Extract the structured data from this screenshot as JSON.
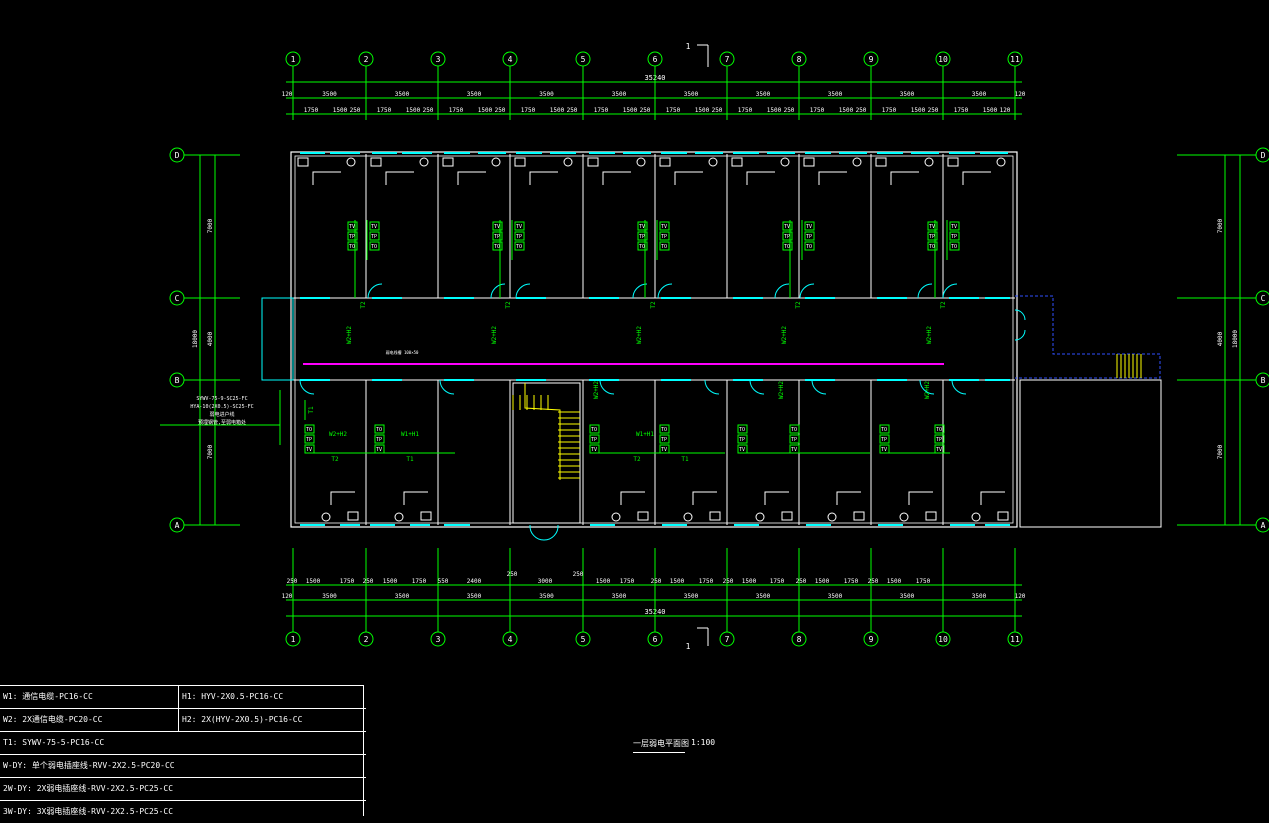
{
  "axes_h": [
    "1",
    "2",
    "3",
    "4",
    "5",
    "6",
    "7",
    "8",
    "9",
    "10",
    "11"
  ],
  "axes_v": [
    "D",
    "C",
    "B",
    "A"
  ],
  "section_mark": "1",
  "dims": {
    "total": "35240",
    "edge": "120",
    "bays": [
      "3500",
      "3500",
      "3500",
      "3500",
      "3500",
      "3500",
      "3500",
      "3500",
      "3500",
      "3500"
    ],
    "top_detail": [
      "1750",
      "1500",
      "250",
      "1750",
      "1500",
      "250",
      "1750",
      "1500",
      "250",
      "1750",
      "1500",
      "250",
      "1750",
      "1500",
      "250",
      "1750",
      "1500",
      "250",
      "1750",
      "1500",
      "250",
      "1750",
      "1500",
      "250",
      "1750",
      "1500",
      "250",
      "1750",
      "1500",
      "120"
    ],
    "bottom_detail": [
      "250",
      "1500",
      "1750",
      "250",
      "1500",
      "1750",
      "550",
      "2400",
      "3000",
      "1500",
      "1750",
      "250",
      "1500",
      "1750",
      "250",
      "1500",
      "1750",
      "250",
      "1500",
      "1750",
      "250",
      "1500",
      "1750"
    ],
    "bottom_extra": [
      "250",
      "250"
    ],
    "left": [
      "7000",
      "4000",
      "7000",
      "18000"
    ],
    "right": [
      "7000",
      "4000",
      "7000",
      "18000"
    ]
  },
  "labels": {
    "riser_tv": "TV",
    "riser_tp": "TP",
    "riser_to": "TO",
    "w2h2": "W2+H2",
    "w1h1": "W1+H1",
    "t2": "T2",
    "t1": "T1",
    "left_notes": [
      "SYWV-75-9-SC25-FC",
      "HYA-10(2X0.5)-SC25-FC",
      "弱电进户线",
      "预埋钢管,至弱电箱处"
    ],
    "corridor_note": "弱电线槽 100×50"
  },
  "legend": {
    "r1a": "W1:  通信电缆-PC16-CC",
    "r1b": "H1: HYV-2X0.5-PC16-CC",
    "r2a": "W2:  2X通信电缆-PC20-CC",
    "r2b": "H2: 2X(HYV-2X0.5)-PC16-CC",
    "r3": "T1:  SYWV-75-5-PC16-CC",
    "r4": "W-DY:  单个弱电插座线-RVV-2X2.5-PC20-CC",
    "r5": "2W-DY:  2X弱电插座线-RVV-2X2.5-PC25-CC",
    "r6": "3W-DY:  3X弱电插座线-RVV-2X2.5-PC25-CC"
  },
  "title": {
    "name": "一层弱电平面图",
    "scale": "1:100"
  },
  "colors": {
    "axis": "#00ff00",
    "wall": "#ffffff",
    "window": "#00ffff",
    "door": "#00ffff",
    "wire": "#00ff00",
    "tray": "#ff00ff",
    "stair": "#ffff00"
  }
}
